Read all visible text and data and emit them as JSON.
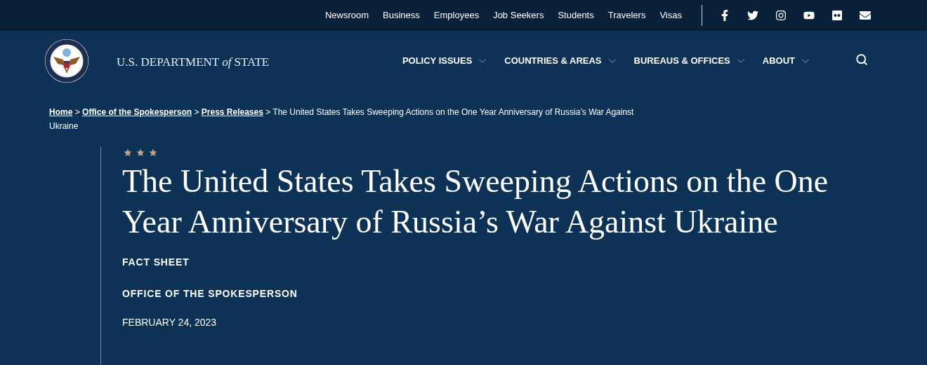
{
  "utility_links": [
    "Newsroom",
    "Business",
    "Employees",
    "Job Seekers",
    "Students",
    "Travelers",
    "Visas"
  ],
  "social_icons": [
    {
      "kind": "facebook"
    },
    {
      "kind": "twitter"
    },
    {
      "kind": "instagram"
    },
    {
      "kind": "youtube"
    },
    {
      "kind": "flickr"
    },
    {
      "kind": "email"
    }
  ],
  "logo": {
    "text_before": "U.S. DEPARTMENT ",
    "text_italic": "of",
    "text_after": " STATE"
  },
  "main_nav": [
    "POLICY ISSUES",
    "COUNTRIES & AREAS",
    "BUREAUS & OFFICES",
    "ABOUT"
  ],
  "breadcrumb": {
    "links": [
      "Home",
      "Office of the Spokesperson",
      "Press Releases"
    ],
    "separator": ">",
    "current": "The United States Takes Sweeping Actions on the One Year Anniversary of Russia’s War Against Ukraine"
  },
  "article": {
    "title": "The United States Takes Sweeping Actions on the One Year Anniversary of Russia’s War Against Ukraine",
    "type": "FACT SHEET",
    "office": "OFFICE OF THE SPOKESPERSON",
    "date": "FEBRUARY 24, 2023"
  }
}
